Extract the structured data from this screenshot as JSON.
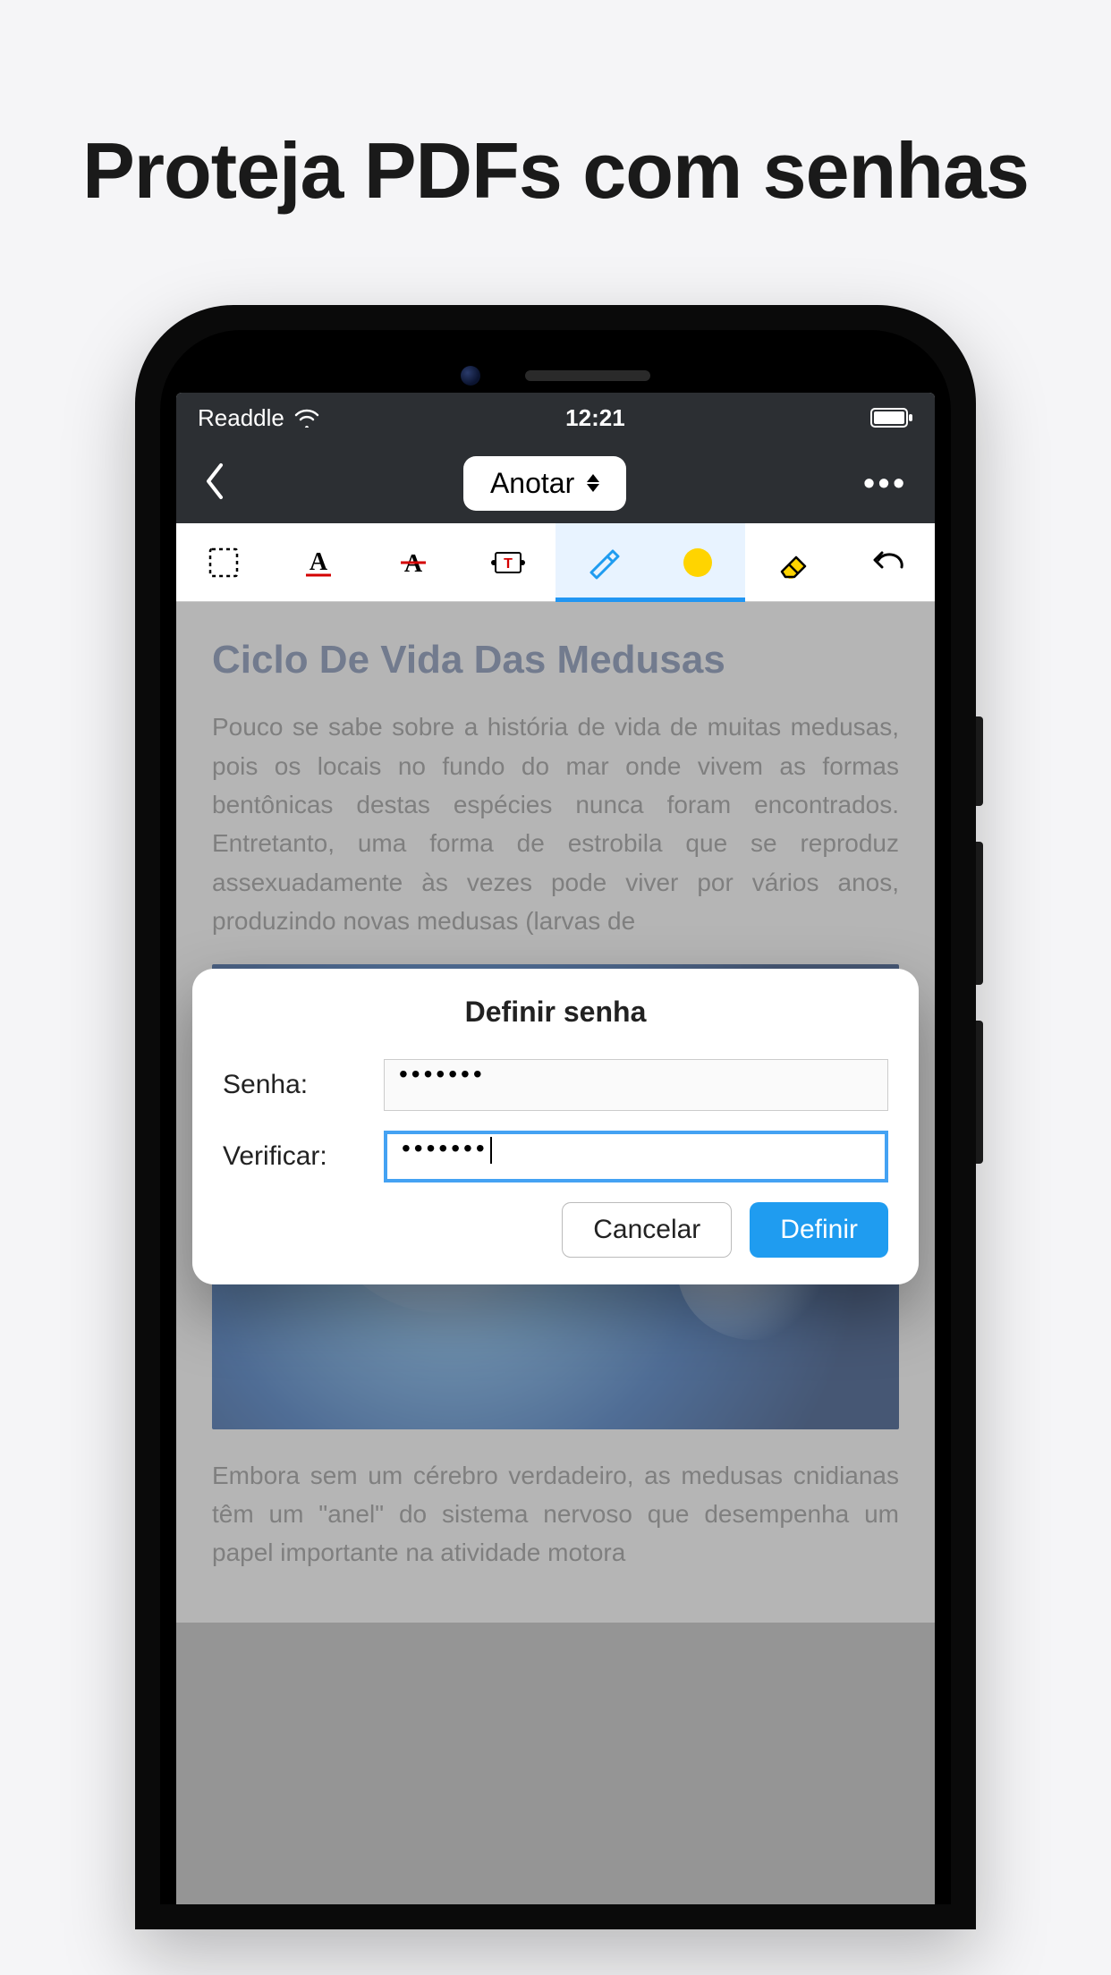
{
  "marketing": {
    "title": "Proteja PDFs com senhas"
  },
  "statusbar": {
    "carrier": "Readdle",
    "time": "12:21"
  },
  "navbar": {
    "mode_label": "Anotar"
  },
  "toolbar": {
    "highlight_color": "#ffd400"
  },
  "document": {
    "title": "Ciclo De Vida Das Medusas",
    "para1": "Pouco se sabe sobre a história de vida de muitas medusas, pois os locais no fundo do mar onde vivem as formas bentônicas destas espécies nunca foram encontrados. Entretanto, uma forma de estrobila que se reproduz assexuadamente às vezes pode viver por vários anos, produzindo novas medusas (larvas de",
    "para2": "Embora sem um cérebro verdadeiro, as medusas cnidianas têm um \"anel\" do sistema nervoso que desempenha um papel importante na atividade motora"
  },
  "dialog": {
    "title": "Definir senha",
    "label_password": "Senha:",
    "label_verify": "Verificar:",
    "value_password": "•••••••",
    "value_verify": "•••••••",
    "cancel": "Cancelar",
    "confirm": "Definir"
  }
}
